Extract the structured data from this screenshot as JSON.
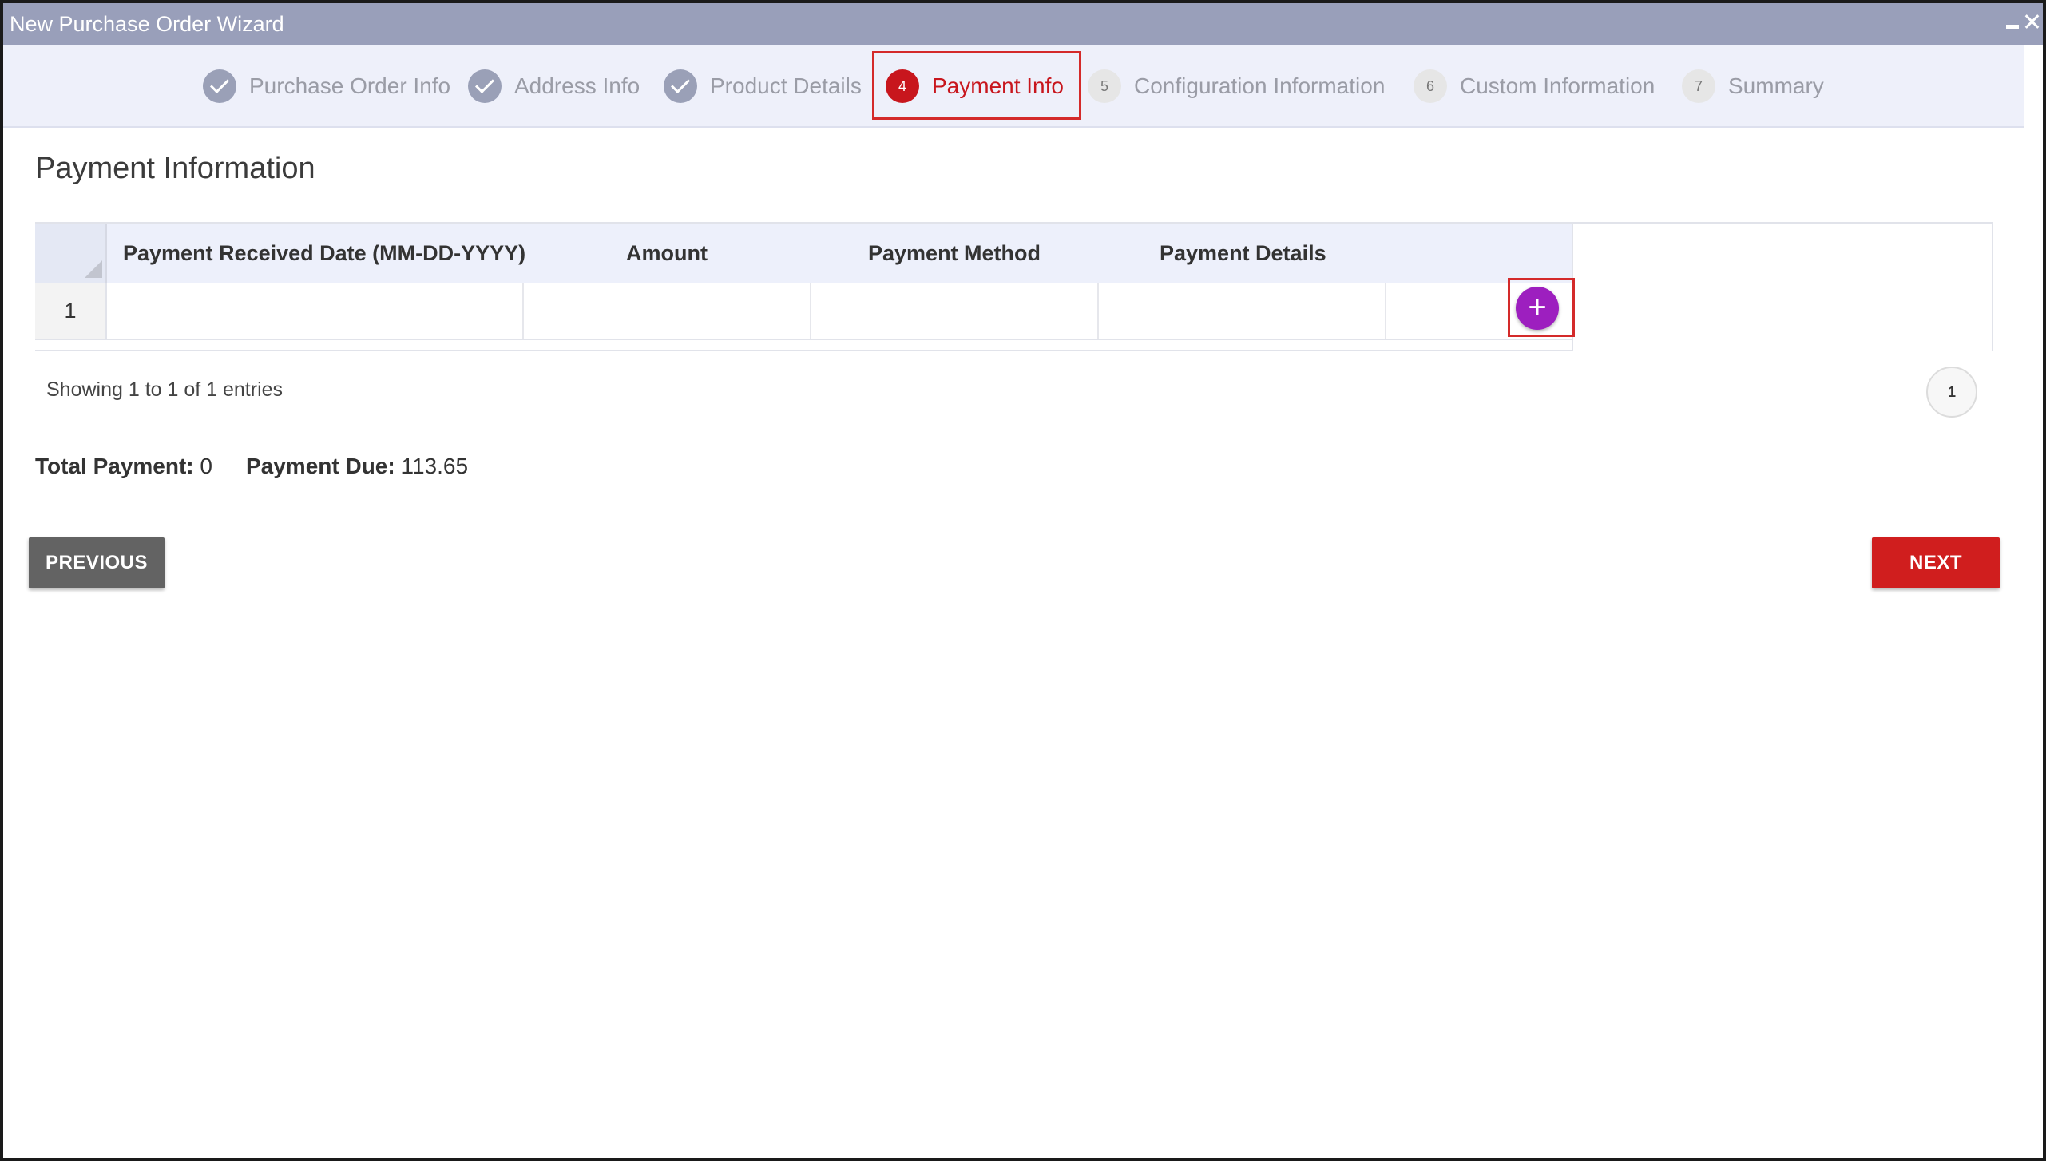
{
  "window": {
    "title": "New Purchase Order Wizard"
  },
  "stepper": {
    "steps": [
      {
        "label": "Purchase Order Info",
        "state": "done",
        "number": ""
      },
      {
        "label": "Address Info",
        "state": "done",
        "number": ""
      },
      {
        "label": "Product Details",
        "state": "done",
        "number": ""
      },
      {
        "label": "Payment Info",
        "state": "active",
        "number": "4"
      },
      {
        "label": "Configuration Information",
        "state": "pending",
        "number": "5"
      },
      {
        "label": "Custom Information",
        "state": "pending",
        "number": "6"
      },
      {
        "label": "Summary",
        "state": "pending",
        "number": "7"
      }
    ]
  },
  "section": {
    "title": "Payment Information"
  },
  "table": {
    "columns": [
      "Payment Received Date (MM-DD-YYYY)",
      "Amount",
      "Payment Method",
      "Payment Details"
    ],
    "rows": [
      {
        "number": "1",
        "cells": [
          "",
          "",
          "",
          ""
        ]
      }
    ],
    "add_button_icon": "plus-icon",
    "add_symbol": "+"
  },
  "pagination": {
    "entries_text": "Showing 1 to 1 of 1 entries",
    "current_page": "1"
  },
  "totals": {
    "total_payment_label": "Total Payment:",
    "total_payment_value": "0",
    "payment_due_label": "Payment Due:",
    "payment_due_value": "113.65"
  },
  "buttons": {
    "previous_label": "PREVIOUS",
    "next_label": "NEXT"
  },
  "colors": {
    "titlebar": "#999fba",
    "stepper_bg": "#eef0fa",
    "accent_red": "#c8161d",
    "add_button": "#9d1fbf",
    "previous_button": "#636363"
  }
}
